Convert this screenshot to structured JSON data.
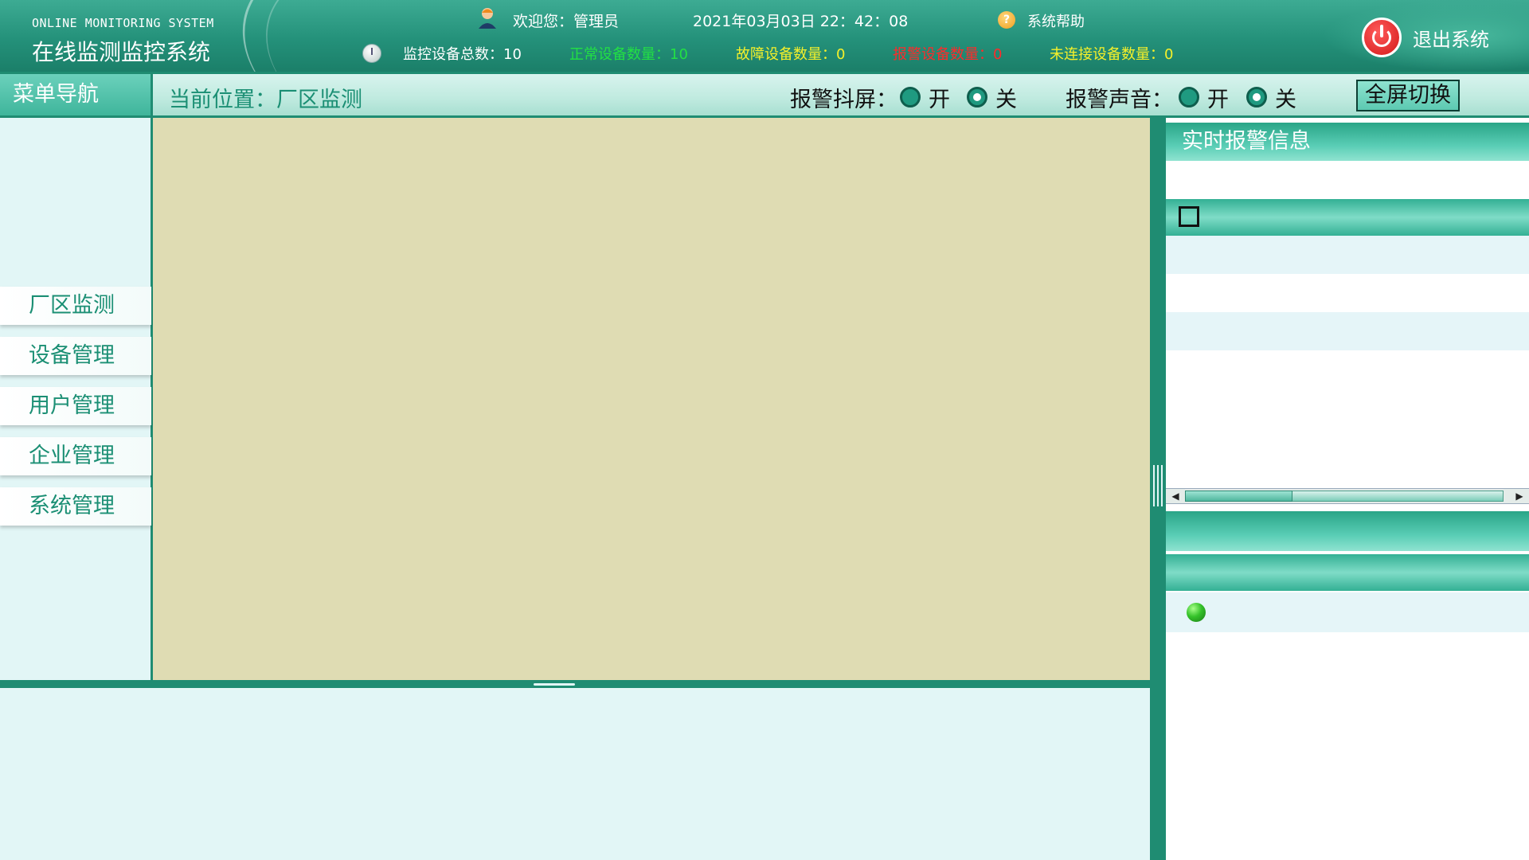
{
  "header": {
    "title_en": "ONLINE MONITORING SYSTEM",
    "title_cn": "在线监测监控系统",
    "welcome": "欢迎您：管理员",
    "datetime": "2021年03月03日 22：42：08",
    "help": "系统帮助",
    "logout": "退出系统",
    "stats": {
      "total": "监控设备总数：10",
      "normal": "正常设备数量：10",
      "fault": "故障设备数量：0",
      "alarm": "报警设备数量：0",
      "disconnected": "未连接设备数量：0"
    },
    "icons": {
      "user": "user-icon",
      "help": "help-icon",
      "monitor": "monitor-icon",
      "logout": "power-icon"
    }
  },
  "subbar": {
    "menu_title": "菜单导航",
    "location": "当前位置：厂区监测",
    "alarm_shake": {
      "label": "报警抖屏：",
      "on": "开",
      "off": "关",
      "selected": "关"
    },
    "alarm_sound": {
      "label": "报警声音：",
      "on": "开",
      "off": "关",
      "selected": "关"
    },
    "fullscreen": "全屏切换"
  },
  "sidebar": {
    "items": [
      {
        "label": "厂区监测"
      },
      {
        "label": "设备管理"
      },
      {
        "label": "用户管理"
      },
      {
        "label": "企业管理"
      },
      {
        "label": "系统管理"
      }
    ]
  },
  "right_panel": {
    "title": "实时报警信息"
  },
  "colors": {
    "primary": "#1f8c72",
    "accent": "#3fb59b",
    "content_bg": "#dfdcb3",
    "stat_normal": "#22e044",
    "stat_warning": "#f5f02a",
    "stat_alarm": "#ff2a2a"
  }
}
